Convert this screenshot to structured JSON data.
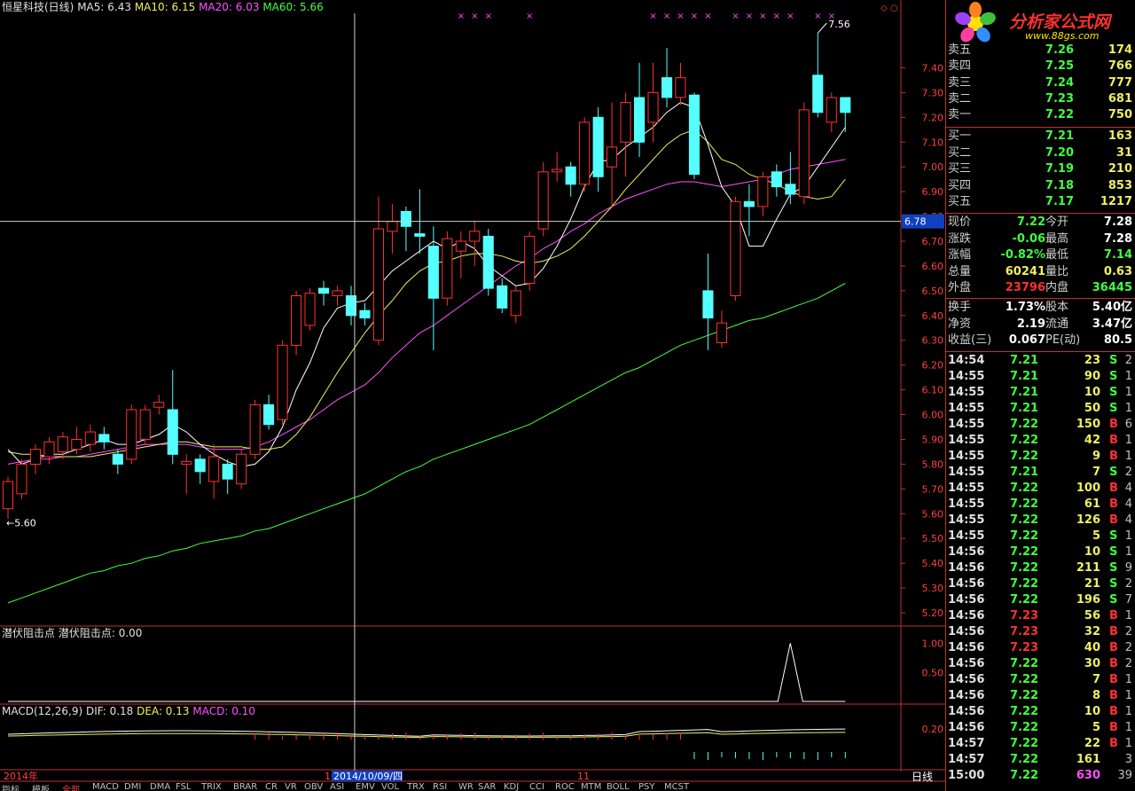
{
  "header": {
    "stock": "恒星科技(日线)",
    "ma5": "MA5: 6.43",
    "ma10": "MA10: 6.15",
    "ma20": "MA20: 6.03",
    "ma60": "MA60: 5.66"
  },
  "sub1": {
    "title": "潜伏阻击点",
    "label": "潜伏阻击点: 0.00"
  },
  "macd": {
    "title": "MACD(12,26,9)",
    "dif": "DIF: 0.18",
    "dea": "DEA: 0.13",
    "macd": "MACD: 0.10"
  },
  "annotations": {
    "high": "7.56",
    "low": "5.60",
    "cursor_price": "6.78",
    "cursor_date": "2014/10/09/四",
    "month_mark": "11",
    "year_mark": "2014年",
    "ten_mark": "10",
    "period": "日线"
  },
  "colors": {
    "up": "#ff3030",
    "down": "#54ffff",
    "ma5": "#ffffff",
    "ma10": "#f0f060",
    "ma20": "#ff50ff",
    "ma60": "#40ff40",
    "axis": "#c03030"
  },
  "logo": {
    "text": "分析家公式网",
    "url": "www.88gs.com"
  },
  "quotes": {
    "asks": [
      {
        "label": "卖五",
        "price": "7.26",
        "vol": "174"
      },
      {
        "label": "卖四",
        "price": "7.25",
        "vol": "766"
      },
      {
        "label": "卖三",
        "price": "7.24",
        "vol": "777"
      },
      {
        "label": "卖二",
        "price": "7.23",
        "vol": "681"
      },
      {
        "label": "卖一",
        "price": "7.22",
        "vol": "750"
      }
    ],
    "bids": [
      {
        "label": "买一",
        "price": "7.21",
        "vol": "163"
      },
      {
        "label": "买二",
        "price": "7.20",
        "vol": "31"
      },
      {
        "label": "买三",
        "price": "7.19",
        "vol": "210"
      },
      {
        "label": "买四",
        "price": "7.18",
        "vol": "853"
      },
      {
        "label": "买五",
        "price": "7.17",
        "vol": "1217"
      }
    ]
  },
  "stats": [
    {
      "l1": "现价",
      "v1": "7.22",
      "l2": "今开",
      "v2": "7.28",
      "c1": "#40ff40",
      "c2": "#ffffff"
    },
    {
      "l1": "涨跌",
      "v1": "-0.06",
      "l2": "最高",
      "v2": "7.28",
      "c1": "#40ff40",
      "c2": "#ffffff"
    },
    {
      "l1": "涨幅",
      "v1": "-0.82%",
      "l2": "最低",
      "v2": "7.14",
      "c1": "#40ff40",
      "c2": "#40ff40"
    },
    {
      "l1": "总量",
      "v1": "60241",
      "l2": "量比",
      "v2": "0.63",
      "c1": "#f0f060",
      "c2": "#f0f060"
    },
    {
      "l1": "外盘",
      "v1": "23796",
      "l2": "内盘",
      "v2": "36445",
      "c1": "#ff3030",
      "c2": "#40ff40"
    },
    {
      "l1": "换手",
      "v1": "1.73%",
      "l2": "股本",
      "v2": "5.40亿",
      "c1": "#ffffff",
      "c2": "#ffffff"
    },
    {
      "l1": "净资",
      "v1": "2.19",
      "l2": "流通",
      "v2": "3.47亿",
      "c1": "#ffffff",
      "c2": "#ffffff"
    },
    {
      "l1": "收益(三)",
      "v1": "0.067",
      "l2": "PE(动)",
      "v2": "80.5",
      "c1": "#ffffff",
      "c2": "#ffffff"
    }
  ],
  "ticks": [
    {
      "t": "14:54",
      "p": "7.21",
      "v": "23",
      "f": "S",
      "n": "2"
    },
    {
      "t": "14:55",
      "p": "7.21",
      "v": "90",
      "f": "S",
      "n": "1"
    },
    {
      "t": "14:55",
      "p": "7.21",
      "v": "10",
      "f": "S",
      "n": "1"
    },
    {
      "t": "14:55",
      "p": "7.21",
      "v": "50",
      "f": "S",
      "n": "1"
    },
    {
      "t": "14:55",
      "p": "7.22",
      "v": "150",
      "f": "B",
      "n": "6"
    },
    {
      "t": "14:55",
      "p": "7.22",
      "v": "42",
      "f": "B",
      "n": "1"
    },
    {
      "t": "14:55",
      "p": "7.22",
      "v": "9",
      "f": "B",
      "n": "1"
    },
    {
      "t": "14:55",
      "p": "7.21",
      "v": "7",
      "f": "S",
      "n": "2"
    },
    {
      "t": "14:55",
      "p": "7.22",
      "v": "100",
      "f": "B",
      "n": "4"
    },
    {
      "t": "14:55",
      "p": "7.22",
      "v": "61",
      "f": "B",
      "n": "4"
    },
    {
      "t": "14:55",
      "p": "7.22",
      "v": "126",
      "f": "B",
      "n": "4"
    },
    {
      "t": "14:55",
      "p": "7.22",
      "v": "5",
      "f": "S",
      "n": "1"
    },
    {
      "t": "14:56",
      "p": "7.22",
      "v": "10",
      "f": "S",
      "n": "1"
    },
    {
      "t": "14:56",
      "p": "7.22",
      "v": "211",
      "f": "S",
      "n": "9"
    },
    {
      "t": "14:56",
      "p": "7.22",
      "v": "21",
      "f": "S",
      "n": "2"
    },
    {
      "t": "14:56",
      "p": "7.22",
      "v": "196",
      "f": "S",
      "n": "7"
    },
    {
      "t": "14:56",
      "p": "7.23",
      "v": "56",
      "f": "B",
      "n": "1"
    },
    {
      "t": "14:56",
      "p": "7.23",
      "v": "32",
      "f": "B",
      "n": "2"
    },
    {
      "t": "14:56",
      "p": "7.23",
      "v": "40",
      "f": "B",
      "n": "2"
    },
    {
      "t": "14:56",
      "p": "7.22",
      "v": "30",
      "f": "B",
      "n": "2"
    },
    {
      "t": "14:56",
      "p": "7.22",
      "v": "7",
      "f": "B",
      "n": "1"
    },
    {
      "t": "14:56",
      "p": "7.22",
      "v": "8",
      "f": "B",
      "n": "1"
    },
    {
      "t": "14:56",
      "p": "7.22",
      "v": "10",
      "f": "B",
      "n": "1"
    },
    {
      "t": "14:56",
      "p": "7.22",
      "v": "5",
      "f": "B",
      "n": "1"
    },
    {
      "t": "14:57",
      "p": "7.22",
      "v": "22",
      "f": "B",
      "n": "1"
    },
    {
      "t": "14:57",
      "p": "7.22",
      "v": "161",
      "f": "",
      "n": "3"
    },
    {
      "t": "15:00",
      "p": "7.22",
      "v": "630",
      "f": "",
      "n": "39"
    }
  ],
  "bottom_tabs": [
    "指标",
    "模板",
    "全部",
    "MACD",
    "DMI",
    "DMA",
    "FSL",
    "TRIX",
    "BRAR",
    "CR",
    "VR",
    "OBV",
    "ASI",
    "EMV",
    "VOL",
    "TRX",
    "RSI",
    "WR",
    "SAR",
    "KDJ",
    "CCI",
    "ROC",
    "MTM",
    "BOLL",
    "PSY",
    "MCST"
  ],
  "chart_data": {
    "type": "candlestick",
    "title": "恒星科技(日线)",
    "ylim": [
      5.15,
      7.62
    ],
    "yticks": [
      "7.40",
      "7.30",
      "7.20",
      "7.10",
      "7.00",
      "6.90",
      "6.80",
      "6.70",
      "6.60",
      "6.50",
      "6.40",
      "6.30",
      "6.20",
      "6.10",
      "6.00",
      "5.90",
      "5.80",
      "5.70",
      "5.60",
      "5.50",
      "5.40",
      "5.30",
      "5.20"
    ],
    "candles": [
      {
        "o": 5.62,
        "c": 5.73,
        "h": 5.75,
        "l": 5.58
      },
      {
        "o": 5.68,
        "c": 5.8,
        "h": 5.82,
        "l": 5.66
      },
      {
        "o": 5.8,
        "c": 5.86,
        "h": 5.88,
        "l": 5.76
      },
      {
        "o": 5.83,
        "c": 5.89,
        "h": 5.91,
        "l": 5.8
      },
      {
        "o": 5.85,
        "c": 5.91,
        "h": 5.93,
        "l": 5.82
      },
      {
        "o": 5.86,
        "c": 5.9,
        "h": 5.95,
        "l": 5.84
      },
      {
        "o": 5.88,
        "c": 5.93,
        "h": 5.96,
        "l": 5.85
      },
      {
        "o": 5.92,
        "c": 5.89,
        "h": 5.95,
        "l": 5.86
      },
      {
        "o": 5.84,
        "c": 5.8,
        "h": 5.86,
        "l": 5.76
      },
      {
        "o": 5.82,
        "c": 6.02,
        "h": 6.04,
        "l": 5.8
      },
      {
        "o": 5.9,
        "c": 6.02,
        "h": 6.04,
        "l": 5.88
      },
      {
        "o": 6.03,
        "c": 6.05,
        "h": 6.08,
        "l": 6.0
      },
      {
        "o": 6.02,
        "c": 5.84,
        "h": 6.18,
        "l": 5.8
      },
      {
        "o": 5.8,
        "c": 5.81,
        "h": 5.84,
        "l": 5.68
      },
      {
        "o": 5.82,
        "c": 5.77,
        "h": 5.84,
        "l": 5.72
      },
      {
        "o": 5.73,
        "c": 5.83,
        "h": 5.88,
        "l": 5.66
      },
      {
        "o": 5.8,
        "c": 5.74,
        "h": 5.82,
        "l": 5.68
      },
      {
        "o": 5.72,
        "c": 5.84,
        "h": 5.86,
        "l": 5.7
      },
      {
        "o": 5.84,
        "c": 6.04,
        "h": 6.06,
        "l": 5.82
      },
      {
        "o": 6.04,
        "c": 5.96,
        "h": 6.08,
        "l": 5.94
      },
      {
        "o": 5.98,
        "c": 6.28,
        "h": 6.3,
        "l": 5.96
      },
      {
        "o": 6.28,
        "c": 6.48,
        "h": 6.5,
        "l": 6.24
      },
      {
        "o": 6.36,
        "c": 6.49,
        "h": 6.51,
        "l": 6.34
      },
      {
        "o": 6.51,
        "c": 6.49,
        "h": 6.54,
        "l": 6.44
      },
      {
        "o": 6.48,
        "c": 6.5,
        "h": 6.52,
        "l": 6.44
      },
      {
        "o": 6.48,
        "c": 6.4,
        "h": 6.52,
        "l": 6.36
      },
      {
        "o": 6.42,
        "c": 6.39,
        "h": 6.45,
        "l": 6.36
      },
      {
        "o": 6.3,
        "c": 6.75,
        "h": 6.88,
        "l": 6.28
      },
      {
        "o": 6.74,
        "c": 6.78,
        "h": 6.85,
        "l": 6.65
      },
      {
        "o": 6.82,
        "c": 6.76,
        "h": 6.84,
        "l": 6.66
      },
      {
        "o": 6.73,
        "c": 6.72,
        "h": 6.91,
        "l": 6.65
      },
      {
        "o": 6.68,
        "c": 6.47,
        "h": 6.76,
        "l": 6.26
      },
      {
        "o": 6.47,
        "c": 6.71,
        "h": 6.74,
        "l": 6.44
      },
      {
        "o": 6.66,
        "c": 6.7,
        "h": 6.74,
        "l": 6.55
      },
      {
        "o": 6.7,
        "c": 6.74,
        "h": 6.78,
        "l": 6.6
      },
      {
        "o": 6.72,
        "c": 6.51,
        "h": 6.75,
        "l": 6.48
      },
      {
        "o": 6.52,
        "c": 6.43,
        "h": 6.55,
        "l": 6.41
      },
      {
        "o": 6.4,
        "c": 6.5,
        "h": 6.52,
        "l": 6.37
      },
      {
        "o": 6.53,
        "c": 6.72,
        "h": 6.74,
        "l": 6.5
      },
      {
        "o": 6.75,
        "c": 6.98,
        "h": 7.02,
        "l": 6.72
      },
      {
        "o": 6.98,
        "c": 6.99,
        "h": 7.06,
        "l": 6.94
      },
      {
        "o": 7.0,
        "c": 6.93,
        "h": 7.02,
        "l": 6.88
      },
      {
        "o": 6.93,
        "c": 7.18,
        "h": 7.2,
        "l": 6.9
      },
      {
        "o": 7.2,
        "c": 6.96,
        "h": 7.24,
        "l": 6.9
      },
      {
        "o": 7.0,
        "c": 7.08,
        "h": 7.26,
        "l": 6.84
      },
      {
        "o": 7.1,
        "c": 7.26,
        "h": 7.3,
        "l": 6.96
      },
      {
        "o": 7.28,
        "c": 7.1,
        "h": 7.42,
        "l": 7.04
      },
      {
        "o": 7.18,
        "c": 7.3,
        "h": 7.42,
        "l": 7.1
      },
      {
        "o": 7.36,
        "c": 7.28,
        "h": 7.48,
        "l": 7.24
      },
      {
        "o": 7.28,
        "c": 7.36,
        "h": 7.42,
        "l": 7.25
      },
      {
        "o": 7.29,
        "c": 6.97,
        "h": 7.3,
        "l": 6.95
      },
      {
        "o": 6.5,
        "c": 6.39,
        "h": 6.65,
        "l": 6.26
      },
      {
        "o": 6.29,
        "c": 6.37,
        "h": 6.42,
        "l": 6.27
      },
      {
        "o": 6.48,
        "c": 6.86,
        "h": 6.88,
        "l": 6.46
      },
      {
        "o": 6.86,
        "c": 6.84,
        "h": 6.93,
        "l": 6.72
      },
      {
        "o": 6.84,
        "c": 6.96,
        "h": 6.98,
        "l": 6.8
      },
      {
        "o": 6.98,
        "c": 6.92,
        "h": 7.01,
        "l": 6.88
      },
      {
        "o": 6.93,
        "c": 6.89,
        "h": 7.06,
        "l": 6.85
      },
      {
        "o": 6.88,
        "c": 7.23,
        "h": 7.26,
        "l": 6.85
      },
      {
        "o": 7.37,
        "c": 7.22,
        "h": 7.54,
        "l": 7.2
      },
      {
        "o": 7.18,
        "c": 7.28,
        "h": 7.3,
        "l": 7.14
      },
      {
        "o": 7.28,
        "c": 7.22,
        "h": 7.28,
        "l": 7.14
      }
    ],
    "ma5": [
      5.86,
      5.8,
      5.82,
      5.84,
      5.84,
      5.86,
      5.88,
      5.9,
      5.88,
      5.88,
      5.9,
      5.92,
      5.96,
      5.93,
      5.88,
      5.84,
      5.81,
      5.79,
      5.8,
      5.85,
      5.95,
      6.1,
      6.21,
      6.35,
      6.43,
      6.45,
      6.46,
      6.52,
      6.58,
      6.62,
      6.66,
      6.7,
      6.67,
      6.7,
      6.67,
      6.6,
      6.56,
      6.52,
      6.53,
      6.59,
      6.68,
      6.79,
      6.92,
      7.02,
      7.03,
      7.08,
      7.12,
      7.16,
      7.22,
      7.26,
      7.24,
      7.09,
      6.92,
      6.84,
      6.68,
      6.68,
      6.79,
      6.89,
      6.92,
      7.0,
      7.08,
      7.16
    ],
    "ma10": [
      5.85,
      5.84,
      5.84,
      5.83,
      5.83,
      5.83,
      5.83,
      5.84,
      5.85,
      5.86,
      5.87,
      5.88,
      5.89,
      5.89,
      5.88,
      5.87,
      5.87,
      5.87,
      5.86,
      5.86,
      5.87,
      5.92,
      5.99,
      6.08,
      6.17,
      6.25,
      6.33,
      6.4,
      6.46,
      6.53,
      6.58,
      6.61,
      6.62,
      6.64,
      6.65,
      6.65,
      6.64,
      6.62,
      6.61,
      6.62,
      6.64,
      6.67,
      6.72,
      6.78,
      6.84,
      6.91,
      6.97,
      7.03,
      7.09,
      7.13,
      7.15,
      7.1,
      7.03,
      7.01,
      6.97,
      6.95,
      6.93,
      6.9,
      6.88,
      6.87,
      6.88,
      6.95
    ],
    "ma20": [
      5.8,
      5.81,
      5.82,
      5.82,
      5.83,
      5.83,
      5.84,
      5.85,
      5.86,
      5.87,
      5.88,
      5.88,
      5.88,
      5.88,
      5.87,
      5.86,
      5.86,
      5.86,
      5.87,
      5.89,
      5.92,
      5.95,
      5.98,
      6.02,
      6.06,
      6.09,
      6.12,
      6.17,
      6.23,
      6.28,
      6.33,
      6.36,
      6.4,
      6.44,
      6.48,
      6.52,
      6.56,
      6.6,
      6.63,
      6.67,
      6.7,
      6.74,
      6.77,
      6.81,
      6.84,
      6.87,
      6.89,
      6.91,
      6.93,
      6.94,
      6.94,
      6.93,
      6.92,
      6.93,
      6.94,
      6.95,
      6.97,
      6.99,
      7.0,
      7.01,
      7.02,
      7.03
    ],
    "ma60": [
      5.24,
      5.26,
      5.28,
      5.3,
      5.32,
      5.34,
      5.36,
      5.37,
      5.39,
      5.4,
      5.42,
      5.43,
      5.45,
      5.46,
      5.48,
      5.49,
      5.5,
      5.51,
      5.53,
      5.54,
      5.56,
      5.58,
      5.6,
      5.62,
      5.64,
      5.66,
      5.68,
      5.71,
      5.74,
      5.77,
      5.79,
      5.82,
      5.84,
      5.86,
      5.88,
      5.9,
      5.92,
      5.94,
      5.96,
      5.99,
      6.02,
      6.05,
      6.08,
      6.11,
      6.14,
      6.17,
      6.19,
      6.22,
      6.25,
      6.28,
      6.3,
      6.32,
      6.34,
      6.36,
      6.38,
      6.39,
      6.41,
      6.43,
      6.45,
      6.47,
      6.5,
      6.53
    ],
    "ma_start_index": 0,
    "signal": {
      "index": 57,
      "value": 1.0,
      "ylim": [
        0,
        1.2
      ],
      "yticks": [
        "1.00",
        "0.50"
      ]
    },
    "macd_ticks": [
      "0.20"
    ],
    "markers_top": [
      33,
      34,
      35,
      38,
      47,
      48,
      49,
      50,
      51,
      53,
      54,
      55,
      56,
      57,
      59,
      60
    ]
  }
}
